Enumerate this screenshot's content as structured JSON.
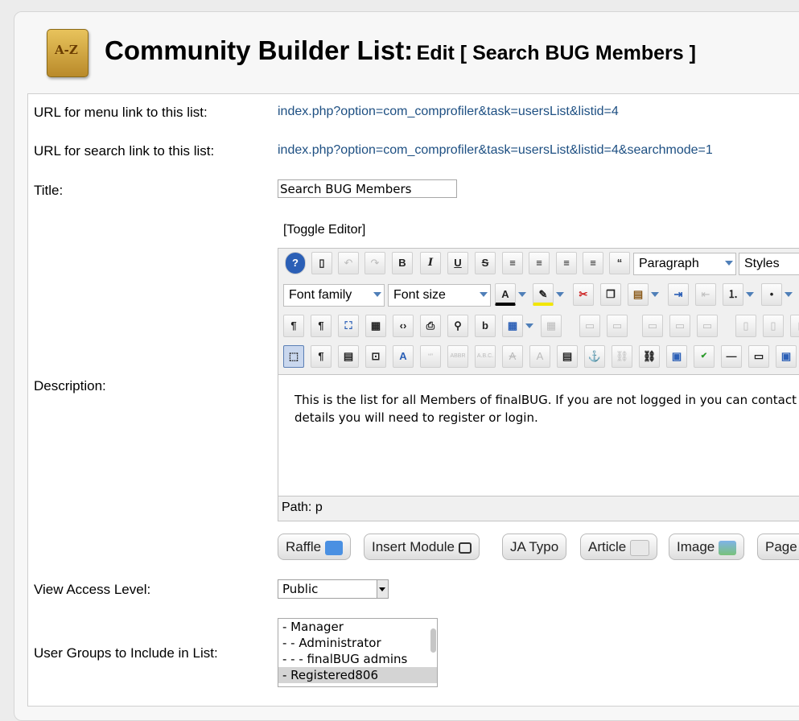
{
  "header": {
    "logo_text": "A-Z",
    "title_main": "Community Builder List:",
    "title_sub": "Edit [ Search BUG Members ]"
  },
  "fields": {
    "menu_url_label": "URL for menu link to this list:",
    "menu_url_value": "index.php?option=com_comprofiler&task=usersList&listid=4",
    "search_url_label": "URL for search link to this list:",
    "search_url_value": "index.php?option=com_comprofiler&task=usersList&listid=4&searchmode=1",
    "title_label": "Title:",
    "title_value": "Search BUG Members",
    "description_label": "Description:",
    "view_access_label": "View Access Level:",
    "view_access_value": "Public",
    "user_groups_label": "User Groups to Include in List:"
  },
  "editor": {
    "toggle_label": "[Toggle Editor]",
    "format_select": "Paragraph",
    "styles_select": "Styles",
    "font_family_select": "Font family",
    "font_size_select": "Font size",
    "content": "This is the list for all Members of finalBUG. If you are not logged in you can contact details you will need to register or login.",
    "path_label": "Path:",
    "path_value": "p"
  },
  "extension_buttons": [
    "Raffle",
    "Insert Module",
    "JA Typo",
    "Article",
    "Image",
    "Page"
  ],
  "user_groups": [
    {
      "label": "- Manager",
      "selected": false
    },
    {
      "label": "- - Administrator",
      "selected": false
    },
    {
      "label": "- - - finalBUG admins",
      "selected": false
    },
    {
      "label": "- Registered806",
      "selected": true
    }
  ]
}
